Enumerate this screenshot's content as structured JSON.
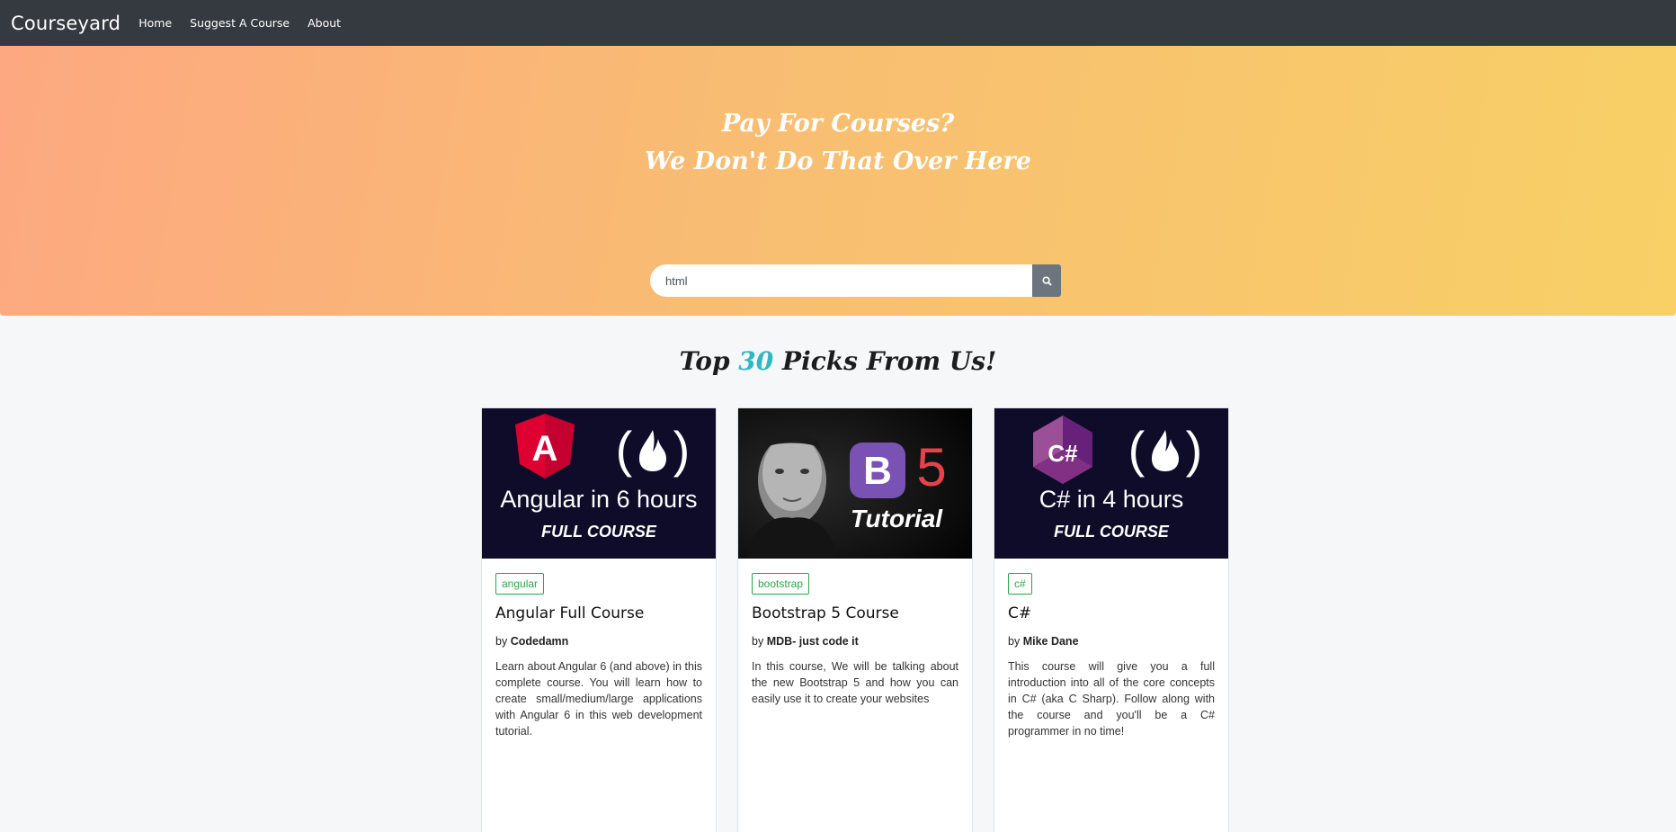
{
  "nav": {
    "brand": "Courseyard",
    "links": [
      "Home",
      "Suggest A Course",
      "About"
    ]
  },
  "hero": {
    "line1": "Pay For Courses?",
    "line2": "We Don't Do That Over Here"
  },
  "search": {
    "value": "html",
    "button_icon": "search-icon"
  },
  "section": {
    "title_prefix": "Top",
    "title_number": "30",
    "title_suffix": "Picks From Us!"
  },
  "colors": {
    "navbar": "#343a40",
    "accent_number": "#2fb8c3",
    "tag_green": "#28a745",
    "hero_start": "#fda880",
    "hero_end": "#f8d066"
  },
  "cards": [
    {
      "tag": "angular",
      "title": "Angular Full Course",
      "author_prefix": "by",
      "author": "Codedamn",
      "description": "Learn about Angular 6 (and above) in this complete course. You will learn how to create small/medium/large applications with Angular 6 in this web development tutorial.",
      "thumb": {
        "main": "Angular in 6 hours",
        "sub": "FULL COURSE",
        "logo_letter": "A"
      }
    },
    {
      "tag": "bootstrap",
      "title": "Bootstrap 5 Course",
      "author_prefix": "by",
      "author": "MDB- just code it",
      "description": "In this course, We will be talking about the new Bootstrap 5 and how you can easily use it to create your websites",
      "thumb": {
        "logo_letter": "B",
        "version": "5",
        "sub": "Tutorial"
      }
    },
    {
      "tag": "c#",
      "title": "C#",
      "author_prefix": "by",
      "author": "Mike Dane",
      "description": "This course will give you a full introduction into all of the core concepts in C# (aka C Sharp). Follow along with the course and you'll be a C# programmer in no time!",
      "thumb": {
        "main": "C# in 4 hours",
        "sub": "FULL COURSE",
        "logo_letter": "C#"
      }
    }
  ]
}
